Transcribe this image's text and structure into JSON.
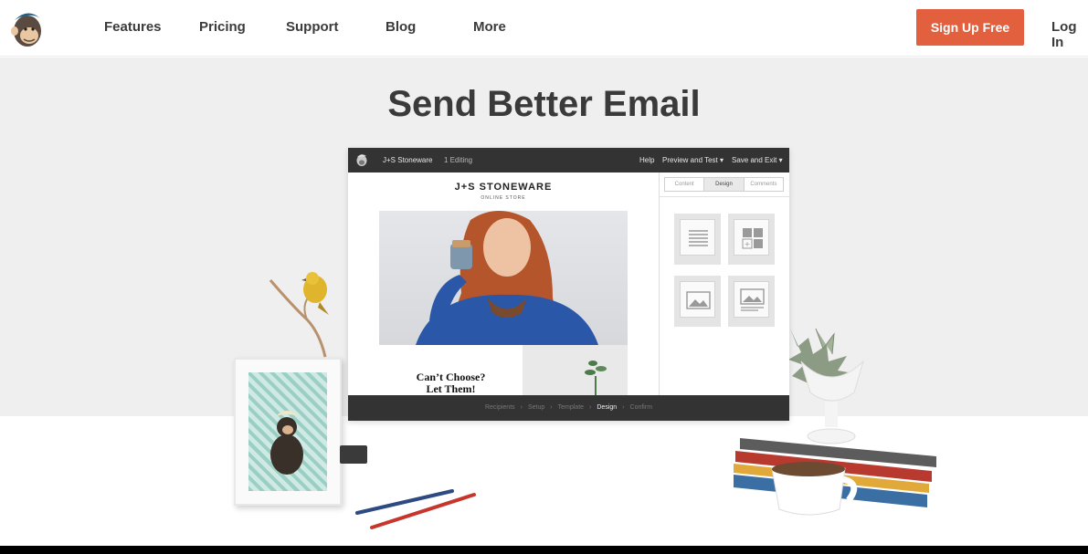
{
  "nav": {
    "links": [
      "Features",
      "Pricing",
      "Support",
      "Blog",
      "More"
    ],
    "signup_label": "Sign Up Free",
    "login_label": "Log In"
  },
  "hero": {
    "title": "Send Better Email"
  },
  "editor": {
    "topbar": {
      "campaign_name": "J+S Stoneware",
      "editing_status": "1 Editing",
      "help_label": "Help",
      "preview_label": "Preview and Test ▾",
      "save_label": "Save and Exit ▾"
    },
    "email": {
      "brand": "J+S STONEWARE",
      "brand_sub": "ONLINE STORE",
      "headline_line1": "Can’t Choose?",
      "headline_line2": "Let Them!"
    },
    "panel_tabs": [
      "Content",
      "Design",
      "Comments"
    ],
    "active_panel_tab": "Design",
    "steps": [
      "Recipients",
      "Setup",
      "Template",
      "Design",
      "Confirm"
    ],
    "active_step": "Design"
  },
  "colors": {
    "accent": "#e2603d",
    "hero_bg": "#efefef",
    "editor_bar": "#333333"
  }
}
